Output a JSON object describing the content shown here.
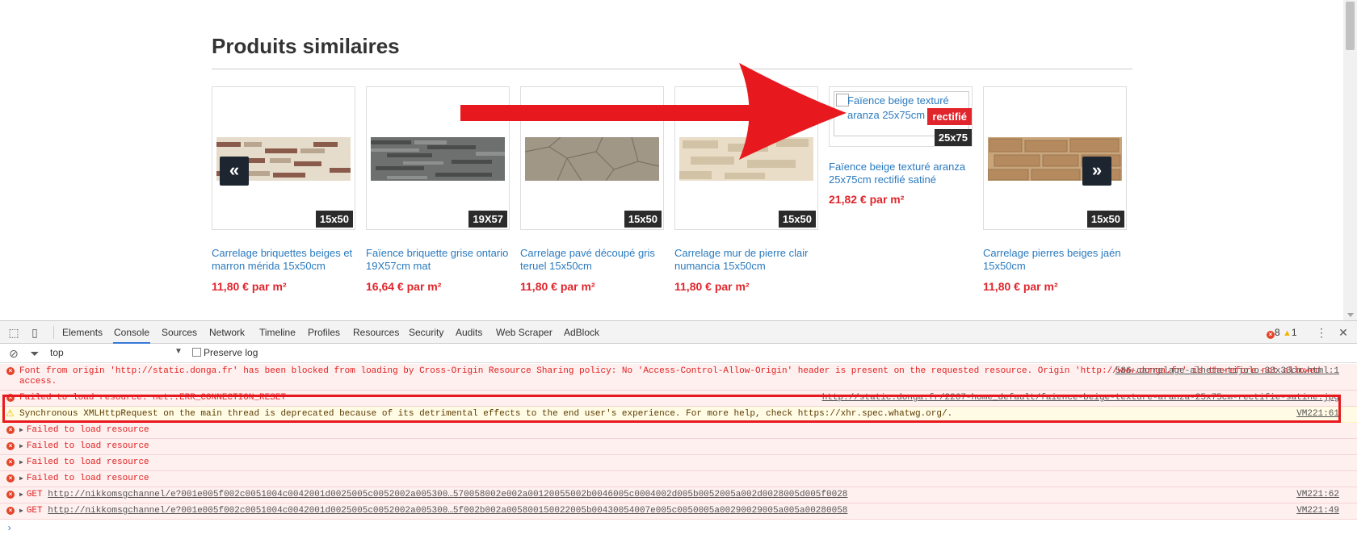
{
  "section": {
    "title": "Produits similaires"
  },
  "products": [
    {
      "size": "15x50",
      "name": "Carrelage briquettes beiges et marron mérida 15x50cm",
      "price": "11,80 € par m²"
    },
    {
      "size": "19X57",
      "name": "Faïence briquette grise ontario 19X57cm mat",
      "price": "16,64 € par m²"
    },
    {
      "size": "15x50",
      "name": "Carrelage pavé découpé gris teruel 15x50cm",
      "price": "11,80 € par m²"
    },
    {
      "size": "15x50",
      "name": "Carrelage mur de pierre clair numancia 15x50cm",
      "price": "11,80 € par m²"
    },
    {
      "size": "25x75",
      "name": "Faïence beige texturé aranza 25x75cm rectifié satiné",
      "price": "21,82 € par m²",
      "alt_text": "Faïence beige texturé aranza 25x75cm satiné",
      "rectifie_label": "rectifié"
    },
    {
      "size": "15x50",
      "name": "Carrelage pierres beiges jaén 15x50cm",
      "price": "11,80 € par m²"
    }
  ],
  "carousel": {
    "prev": "«",
    "next": "»"
  },
  "devtools": {
    "tabs": [
      "Elements",
      "Console",
      "Sources",
      "Network",
      "Timeline",
      "Profiles",
      "Resources",
      "Security",
      "Audits",
      "Web Scraper",
      "AdBlock"
    ],
    "active_tab": "Console",
    "error_count": "8",
    "warning_count": "1",
    "context": "top",
    "preserve_log": "Preserve log",
    "messages": [
      {
        "level": "error",
        "text": "Font from origin 'http://static.donga.fr' has been blocked from loading by Cross-Origin Resource Sharing policy: No 'Access-Control-Allow-Origin' header is present on the requested resource. Origin 'http://www.donga.fr' is therefore not allowed access.",
        "source": "586-carrelage-alheta-tijolo-33x33cm.html:1"
      },
      {
        "level": "error",
        "text": "Failed to load resource: net::ERR_CONNECTION_RESET",
        "source": "http://static.donga.fr/2267-home_default/faience-beige-texture-aranza-25x75cm-rectifie-satine.jpg"
      },
      {
        "level": "warning",
        "text": "Synchronous XMLHttpRequest on the main thread is deprecated because of its detrimental effects to the end user's experience. For more help, check https://xhr.spec.whatwg.org/.",
        "source": "VM221:61"
      },
      {
        "level": "error",
        "text": "Failed to load resource",
        "source": ""
      },
      {
        "level": "error",
        "text": "Failed to load resource",
        "source": ""
      },
      {
        "level": "error",
        "text": "Failed to load resource",
        "source": ""
      },
      {
        "level": "error",
        "text": "Failed to load resource",
        "source": ""
      },
      {
        "level": "error",
        "method": "GET",
        "url": "http://nikkomsgchannel/e?001e005f002c0051004c0042001d0025005c0052002a005300…570058002e002a00120055002b0046005c0004002d005b0052005a002d0028005d005f0028",
        "source": "VM221:62"
      },
      {
        "level": "error",
        "method": "GET",
        "url": "http://nikkomsgchannel/e?001e005f002c0051004c0042001d0025005c0052002a005300…5f002b002a005800150022005b00430054007e005c0050005a00290029005a005a00280058",
        "source": "VM221:49"
      }
    ],
    "prompt": "›"
  },
  "colors": {
    "price": "#e0262c",
    "link": "#2a7abf",
    "annotation": "#e8191e",
    "active_tab": "#3879d9"
  }
}
